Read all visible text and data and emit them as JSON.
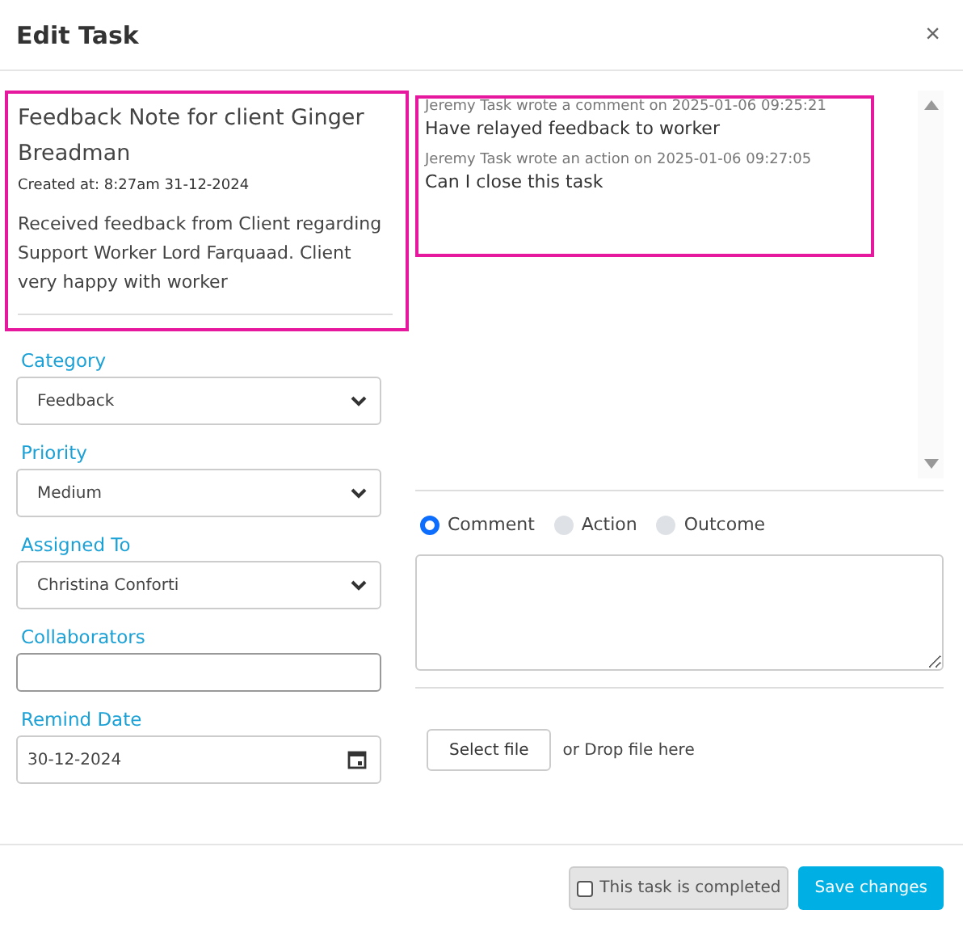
{
  "window": {
    "title": "Edit Task",
    "close": "×"
  },
  "note": {
    "title": "Feedback Note for client Ginger Breadman",
    "created": "Created at: 8:27am 31-12-2024",
    "body": "Received feedback from Client regarding Support Worker Lord Farquaad. Client very happy with worker"
  },
  "comments": [
    {
      "meta": "Jeremy Task wrote a comment on 2025-01-06 09:25:21",
      "text": "Have relayed feedback to worker"
    },
    {
      "meta": "Jeremy Task wrote an action on 2025-01-06 09:27:05",
      "text": "Can I close this task"
    }
  ],
  "fields": [
    {
      "label": "Category",
      "kind": "select",
      "value": "Feedback"
    },
    {
      "label": "Priority",
      "kind": "select",
      "value": "Medium"
    },
    {
      "label": "Assigned To",
      "kind": "select",
      "value": "Christina Conforti"
    },
    {
      "label": "Collaborators",
      "kind": "text"
    },
    {
      "label": "Remind Date",
      "kind": "date",
      "value": "30-12-2024"
    }
  ],
  "entry_types": [
    {
      "label": "Comment",
      "selected": true
    },
    {
      "label": "Action",
      "selected": false
    },
    {
      "label": "Outcome",
      "selected": false
    }
  ],
  "upload": {
    "button": "Select file",
    "hint": "or Drop file here"
  },
  "footer": {
    "completed": {
      "label": "This task is completed",
      "checked": false
    },
    "save": "Save changes"
  }
}
